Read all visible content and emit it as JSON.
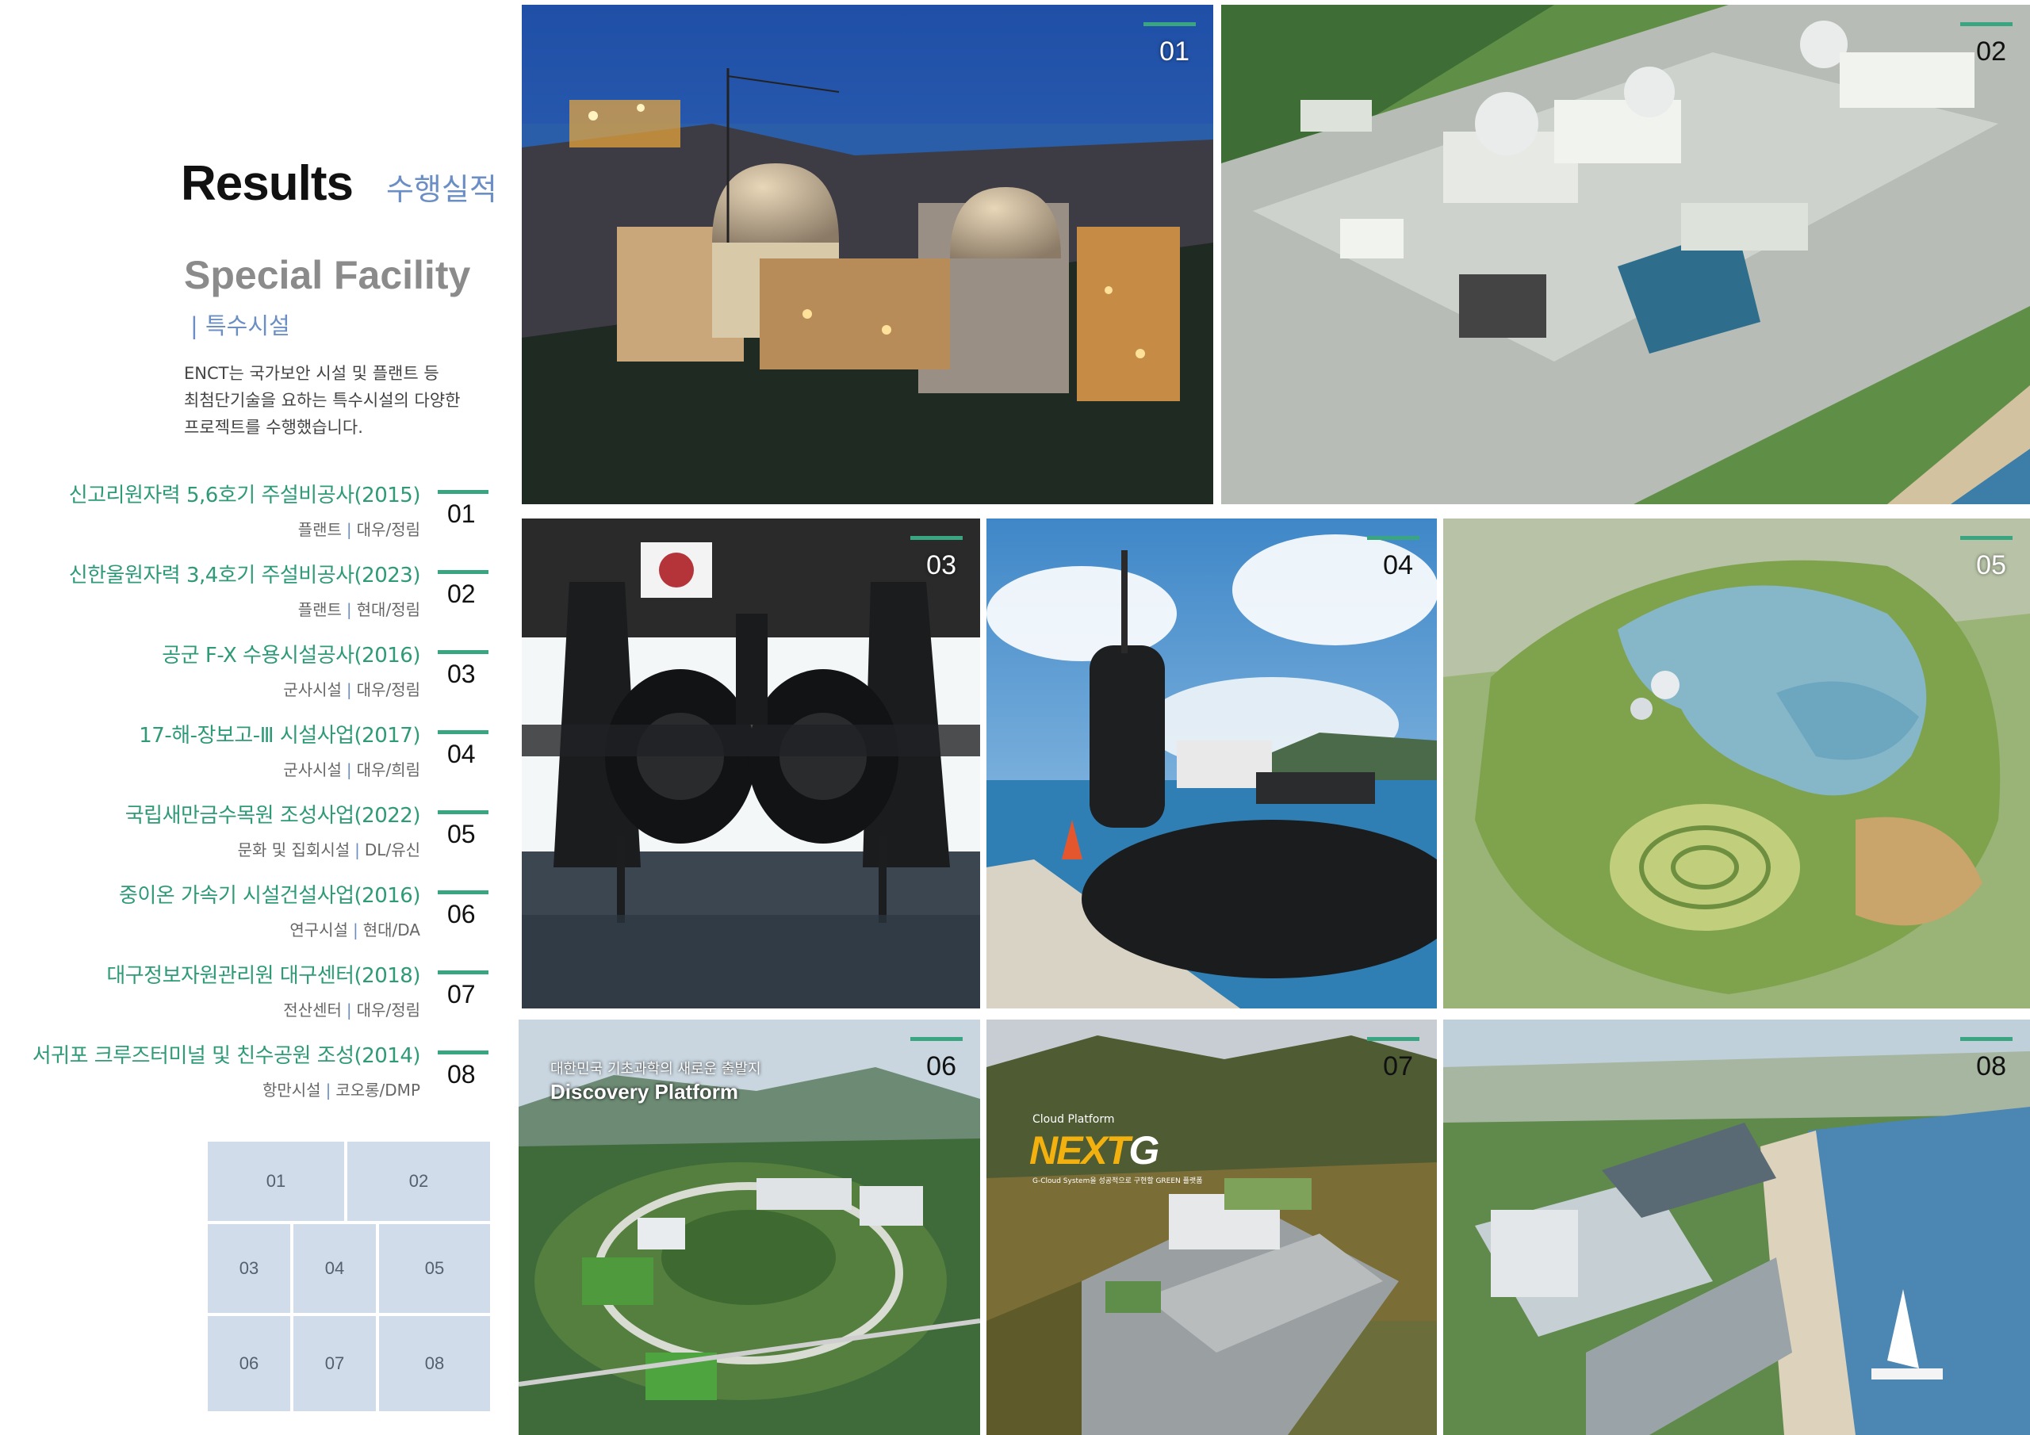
{
  "header": {
    "title_en": "Results",
    "title_ko": "수행실적"
  },
  "section": {
    "title_en": "Special Facility",
    "title_ko": "| 특수시설",
    "description": "ENCT는 국가보안 시설 및 플랜트 등\n최첨단기술을 요하는 특수시설의 다양한\n프로젝트를 수행했습니다."
  },
  "projects": [
    {
      "num": "01",
      "name": "신고리원자력 5,6호기 주설비공사(2015)",
      "category": "플랜트",
      "partners": "대우/정림"
    },
    {
      "num": "02",
      "name": "신한울원자력 3,4호기 주설비공사(2023)",
      "category": "플랜트",
      "partners": "현대/정림"
    },
    {
      "num": "03",
      "name": "공군 F-X 수용시설공사(2016)",
      "category": "군사시설",
      "partners": "대우/정림"
    },
    {
      "num": "04",
      "name": "17-해-장보고-Ⅲ 시설사업(2017)",
      "category": "군사시설",
      "partners": "대우/희림"
    },
    {
      "num": "05",
      "name": "국립새만금수목원 조성사업(2022)",
      "category": "문화 및 집회시설",
      "partners": "DL/유신"
    },
    {
      "num": "06",
      "name": "중이온 가속기 시설건설사업(2016)",
      "category": "연구시설",
      "partners": "현대/DA"
    },
    {
      "num": "07",
      "name": "대구정보자원관리원 대구센터(2018)",
      "category": "전산센터",
      "partners": "대우/정림"
    },
    {
      "num": "08",
      "name": "서귀포 크루즈터미널 및 친수공원 조성(2014)",
      "category": "항만시설",
      "partners": "코오롱/DMP"
    }
  ],
  "separator": "|",
  "key_grid": [
    "01",
    "02",
    "03",
    "04",
    "05",
    "06",
    "07",
    "08"
  ],
  "tiles": [
    {
      "num": "01",
      "scene": "nuclear-plant-night"
    },
    {
      "num": "02",
      "scene": "nuclear-plant-aerial"
    },
    {
      "num": "03",
      "scene": "fighter-jet-hangar"
    },
    {
      "num": "04",
      "scene": "submarine-dock"
    },
    {
      "num": "05",
      "scene": "arboretum-aerial"
    },
    {
      "num": "06",
      "scene": "accelerator-campus",
      "overlay_ko": "대한민국 기초과학의 새로운 출발지",
      "overlay_en": "Discovery Platform"
    },
    {
      "num": "07",
      "scene": "data-center-aerial",
      "cloud_label": "Cloud Platform",
      "logo_main": "NEXT",
      "logo_mark": "G",
      "logo_sub": "G-Cloud System을 성공적으로 구현할 GREEN 플랫폼"
    },
    {
      "num": "08",
      "scene": "cruise-terminal"
    }
  ],
  "colors": {
    "accent_green": "#3aa581",
    "accent_blue": "#6b8fc4",
    "grid_cell": "#d1dcea"
  }
}
